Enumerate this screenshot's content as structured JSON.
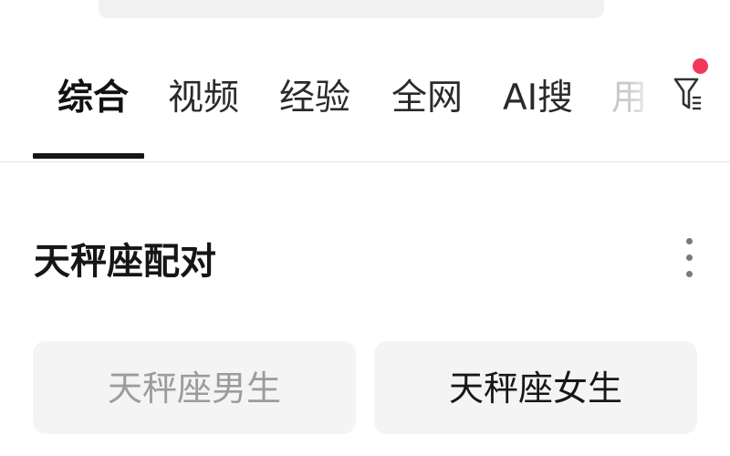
{
  "tabs": [
    {
      "label": "综合",
      "active": true
    },
    {
      "label": "视频",
      "active": false
    },
    {
      "label": "经验",
      "active": false
    },
    {
      "label": "全网",
      "active": false
    },
    {
      "label": "AI搜",
      "active": false
    },
    {
      "label": "用",
      "active": false
    }
  ],
  "filter": {
    "icon": "filter-icon",
    "has_notification": true,
    "notification_color": "#f2375a"
  },
  "section": {
    "title": "天秤座配对",
    "menu_icon": "more-vertical-icon"
  },
  "suggestions": [
    {
      "label": "天秤座男生"
    },
    {
      "label": "天秤座女生"
    }
  ],
  "colors": {
    "accent_underline": "#161616",
    "chip_background": "#f4f4f5"
  }
}
